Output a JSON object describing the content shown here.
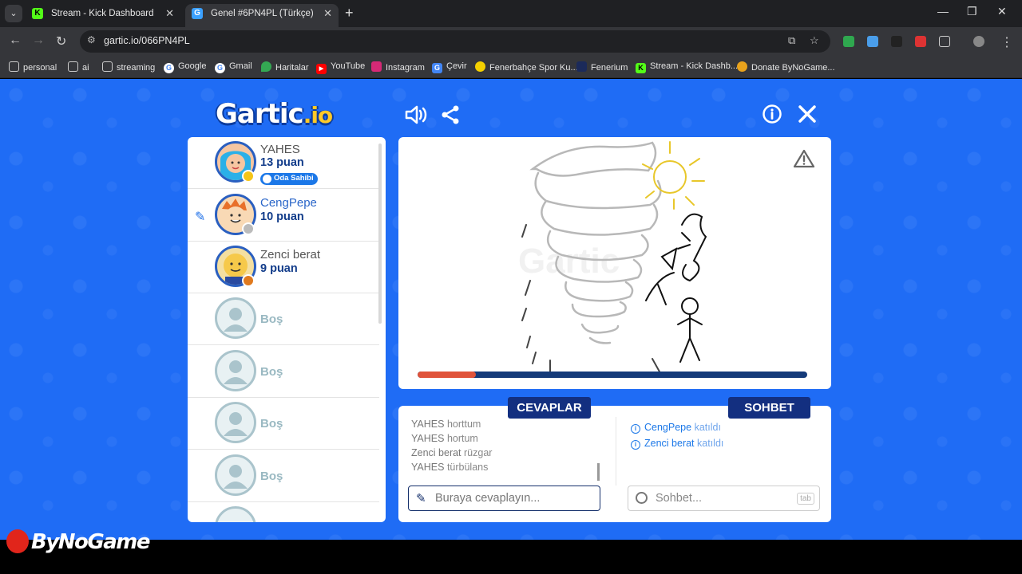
{
  "browser": {
    "tabs": [
      {
        "title": "Stream - Kick Dashboard",
        "active": false,
        "favicon": "kick-icon"
      },
      {
        "title": "Genel #6PN4PL (Türkçe) - Gartic",
        "active": true,
        "favicon": "gartic-icon"
      }
    ],
    "url": "gartic.io/066PN4PL",
    "bookmarks": [
      {
        "label": "personal",
        "icon": "folder-icon"
      },
      {
        "label": "ai",
        "icon": "folder-icon"
      },
      {
        "label": "streaming",
        "icon": "folder-icon"
      },
      {
        "label": "Google",
        "icon": "google-icon"
      },
      {
        "label": "Gmail",
        "icon": "google-icon"
      },
      {
        "label": "Haritalar",
        "icon": "maps-icon"
      },
      {
        "label": "YouTube",
        "icon": "youtube-icon"
      },
      {
        "label": "Instagram",
        "icon": "instagram-icon"
      },
      {
        "label": "Çevir",
        "icon": "translate-icon"
      },
      {
        "label": "Fenerbahçe Spor Ku...",
        "icon": "fenerbahce-icon"
      },
      {
        "label": "Fenerium",
        "icon": "fenerium-icon"
      },
      {
        "label": "Stream - Kick Dashb...",
        "icon": "kick-icon"
      },
      {
        "label": "Donate ByNoGame...",
        "icon": "bynogame-icon"
      }
    ]
  },
  "game": {
    "logo_main": "Gartic",
    "logo_suffix": ".io",
    "players": [
      {
        "name": "YAHES",
        "points": "13 puan",
        "badge": "Oda Sahibi",
        "status_color": "#f5c518"
      },
      {
        "name": "CengPepe",
        "points": "10 puan",
        "drawing": true,
        "status_color": "#bbbbbb"
      },
      {
        "name": "Zenci berat",
        "points": "9 puan",
        "status_color": "#e07a1f"
      },
      {
        "name": "Boş"
      },
      {
        "name": "Boş"
      },
      {
        "name": "Boş"
      },
      {
        "name": "Boş"
      }
    ],
    "timer_progress": 0.15,
    "tabs": {
      "answers": "CEVAPLAR",
      "chat": "SOHBET"
    },
    "answers": [
      {
        "user": "YAHES",
        "guess": "horttum"
      },
      {
        "user": "YAHES",
        "guess": "hortum"
      },
      {
        "user": "Zenci berat",
        "guess": "rüzgar"
      },
      {
        "user": "YAHES",
        "guess": "türbülans"
      }
    ],
    "chat": [
      {
        "user": "CengPepe",
        "text": "katıldı"
      },
      {
        "user": "Zenci berat",
        "text": "katıldı"
      }
    ],
    "answer_placeholder": "Buraya cevaplayın...",
    "chat_placeholder": "Sohbet...",
    "tab_hint": "tab"
  },
  "watermark": "ByNoGame",
  "colors": {
    "stage": "#1f6cf5",
    "panel_dark": "#132f80",
    "accent": "#1c78e8",
    "timer": "#e0533a"
  }
}
